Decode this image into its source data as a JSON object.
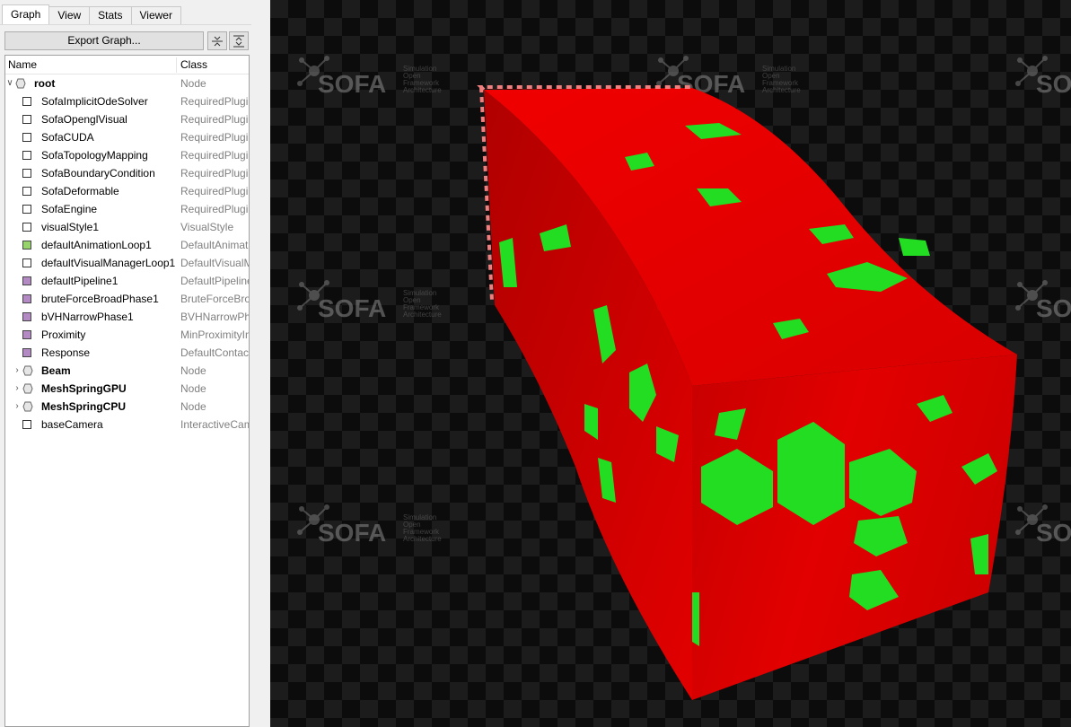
{
  "tabs": [
    "Graph",
    "View",
    "Stats",
    "Viewer"
  ],
  "export_label": "Export Graph...",
  "tree": {
    "col_name": "Name",
    "col_class": "Class",
    "rows": [
      {
        "name": "root",
        "class": "Node",
        "level": 0,
        "icon": "node",
        "bold": true,
        "arrow": "expanded"
      },
      {
        "name": "SofaImplicitOdeSolver",
        "class": "RequiredPlugin",
        "level": 1,
        "icon": "white"
      },
      {
        "name": "SofaOpenglVisual",
        "class": "RequiredPlugin",
        "level": 1,
        "icon": "white"
      },
      {
        "name": "SofaCUDA",
        "class": "RequiredPlugin",
        "level": 1,
        "icon": "white"
      },
      {
        "name": "SofaTopologyMapping",
        "class": "RequiredPlugin",
        "level": 1,
        "icon": "white"
      },
      {
        "name": "SofaBoundaryCondition",
        "class": "RequiredPlugin",
        "level": 1,
        "icon": "white"
      },
      {
        "name": "SofaDeformable",
        "class": "RequiredPlugin",
        "level": 1,
        "icon": "white"
      },
      {
        "name": "SofaEngine",
        "class": "RequiredPlugin",
        "level": 1,
        "icon": "white"
      },
      {
        "name": "visualStyle1",
        "class": "VisualStyle",
        "level": 1,
        "icon": "white"
      },
      {
        "name": "defaultAnimationLoop1",
        "class": "DefaultAnimationLoop",
        "level": 1,
        "icon": "green"
      },
      {
        "name": "defaultVisualManagerLoop1",
        "class": "DefaultVisualManagerLoop",
        "level": 1,
        "icon": "white"
      },
      {
        "name": "defaultPipeline1",
        "class": "DefaultPipeline",
        "level": 1,
        "icon": "purple"
      },
      {
        "name": "bruteForceBroadPhase1",
        "class": "BruteForceBroadPhase",
        "level": 1,
        "icon": "purple"
      },
      {
        "name": "bVHNarrowPhase1",
        "class": "BVHNarrowPhase",
        "level": 1,
        "icon": "purple"
      },
      {
        "name": "Proximity",
        "class": "MinProximityIntersection",
        "level": 1,
        "icon": "purple"
      },
      {
        "name": "Response",
        "class": "DefaultContactManager",
        "level": 1,
        "icon": "purple"
      },
      {
        "name": "Beam",
        "class": "Node",
        "level": 1,
        "icon": "node",
        "bold": true,
        "arrow": "collapsed"
      },
      {
        "name": "MeshSpringGPU",
        "class": "Node",
        "level": 1,
        "icon": "node",
        "bold": true,
        "arrow": "collapsed"
      },
      {
        "name": "MeshSpringCPU",
        "class": "Node",
        "level": 1,
        "icon": "node",
        "bold": true,
        "arrow": "collapsed"
      },
      {
        "name": "baseCamera",
        "class": "InteractiveCamera",
        "level": 1,
        "icon": "white"
      }
    ]
  },
  "viewer": {
    "logo_text": "SOFA",
    "logo_sub": [
      "Simulation",
      "Open",
      "Framework",
      "Architecture"
    ],
    "colors": {
      "mesh": "#e00000",
      "patches": "#22dd22",
      "selection": "#f08080",
      "checker_dark": "#0c0c0c",
      "checker_light": "#1c1c1c"
    }
  }
}
